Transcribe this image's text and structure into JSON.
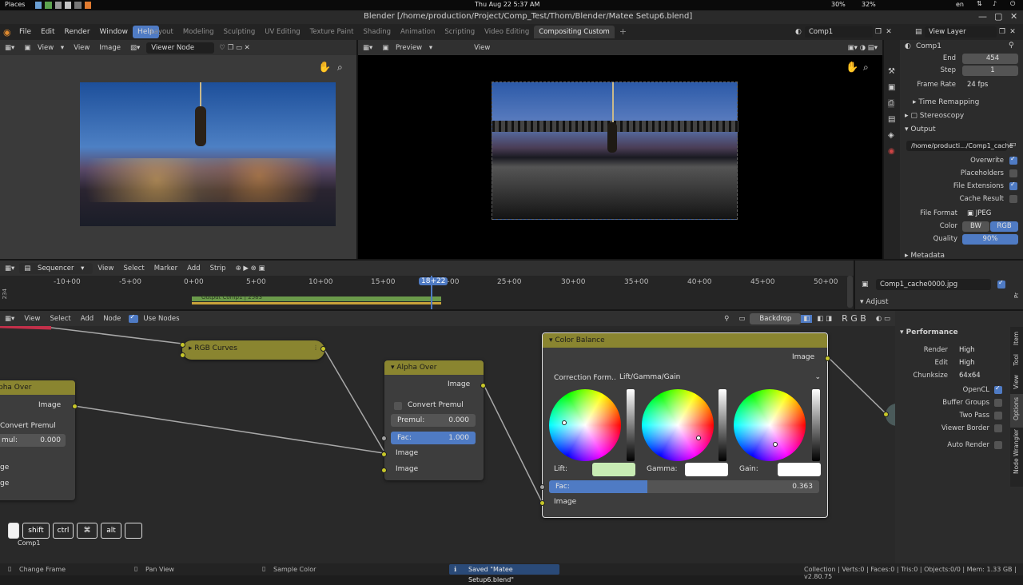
{
  "system_bar": {
    "places": "Places",
    "datetime": "Thu Aug 22   5:37 AM",
    "lang": "en",
    "cpu": "30%",
    "mem": "32%"
  },
  "window_title": "Blender [/home/production/Project/Comp_Test/Thom/Blender/Matee Setup6.blend]",
  "menu": {
    "items": [
      "File",
      "Edit",
      "Render",
      "Window",
      "Help"
    ],
    "active": "Help"
  },
  "workspaces": [
    "Layout",
    "Modeling",
    "Sculpting",
    "UV Editing",
    "Texture Paint",
    "Shading",
    "Animation",
    "Scripting",
    "Video Editing",
    "Compositing Custom"
  ],
  "active_workspace": "Compositing Custom",
  "scene": {
    "name": "Comp1",
    "view_layer": "View Layer"
  },
  "image_editor": {
    "view": "View",
    "menu_view": "View",
    "menu_image": "Image",
    "image_name": "Viewer Node"
  },
  "preview_editor": {
    "mode": "Preview",
    "view": "View"
  },
  "properties": {
    "object": "Comp1",
    "end_label": "End",
    "end": "454",
    "step_label": "Step",
    "step": "1",
    "frame_rate_label": "Frame Rate",
    "frame_rate": "24 fps",
    "time_remapping": "Time Remapping",
    "stereoscopy": "Stereoscopy",
    "output": "Output",
    "path": "/home/producti.../Comp1_cache",
    "overwrite": "Overwrite",
    "placeholders": "Placeholders",
    "file_extensions": "File Extensions",
    "cache_result": "Cache Result",
    "file_format_label": "File Format",
    "file_format": "JPEG",
    "color_label": "Color",
    "bw": "BW",
    "rgb": "RGB",
    "quality_label": "Quality",
    "quality": "90%",
    "metadata": "Metadata"
  },
  "sequencer": {
    "mode": "Sequencer",
    "menus": [
      "View",
      "Select",
      "Marker",
      "Add",
      "Strip"
    ],
    "ticks": [
      "-10+00",
      "-5+00",
      "0+00",
      "5+00",
      "10+00",
      "15+00",
      "20+00",
      "25+00",
      "30+00",
      "35+00",
      "40+00",
      "45+00",
      "50+00"
    ],
    "current": "18+22",
    "strip_label": "Output Comp1 | 2583",
    "channel": "234"
  },
  "image_panel": {
    "filename": "Comp1_cache0000.jpg",
    "adjust": "Adjust"
  },
  "node_editor": {
    "menus": [
      "View",
      "Select",
      "Add",
      "Node"
    ],
    "use_nodes": "Use Nodes",
    "backdrop": "Backdrop",
    "rgb_letters": "R G B",
    "rgb_curves": "RGB Curves",
    "alpha_over_left": {
      "title": "pha Over",
      "image": "Image",
      "convert": "Convert Premul",
      "premul_label": "mul:",
      "premul": "0.000",
      "in1": "ge",
      "in2": "ge"
    },
    "alpha_over": {
      "title": "Alpha Over",
      "image_out": "Image",
      "convert": "Convert Premul",
      "premul_label": "Premul:",
      "premul": "0.000",
      "fac_label": "Fac:",
      "fac": "1.000",
      "in1": "Image",
      "in2": "Image"
    },
    "color_balance": {
      "title": "Color Balance",
      "image_out": "Image",
      "correction_label": "Correction Form..",
      "correction": "Lift/Gamma/Gain",
      "lift": "Lift:",
      "gamma": "Gamma:",
      "gain": "Gain:",
      "fac_label": "Fac:",
      "fac": "0.363",
      "fac_fraction": 0.363,
      "image_in": "Image",
      "lift_color": "#c8ecb4",
      "gamma_color": "#ffffff",
      "gain_color": "#ffffff"
    },
    "keys": [
      "shift",
      "ctrl",
      "⌘",
      "alt"
    ],
    "key_label": "Comp1"
  },
  "sidebar": {
    "performance": "Performance",
    "render_label": "Render",
    "render": "High",
    "edit_label": "Edit",
    "edit": "High",
    "chunksize_label": "Chunksize",
    "chunksize": "64x64",
    "opencl": "OpenCL",
    "buffer_groups": "Buffer Groups",
    "two_pass": "Two Pass",
    "viewer_border": "Viewer Border",
    "auto_render": "Auto Render",
    "tabs": [
      "Item",
      "Tool",
      "View",
      "Options",
      "Node Wrangler"
    ]
  },
  "status": {
    "change_frame": "Change Frame",
    "pan_view": "Pan View",
    "sample_color": "Sample Color",
    "saved": "Saved \"Matee Setup6.blend\"",
    "stats": "Collection | Verts:0 | Faces:0 | Tris:0 | Objects:0/0 | Mem: 1.33 GB | v2.80.75"
  },
  "colors": {
    "accent": "#4f7bc4",
    "node_header": "#8a8530",
    "socket": "#c7c729"
  }
}
